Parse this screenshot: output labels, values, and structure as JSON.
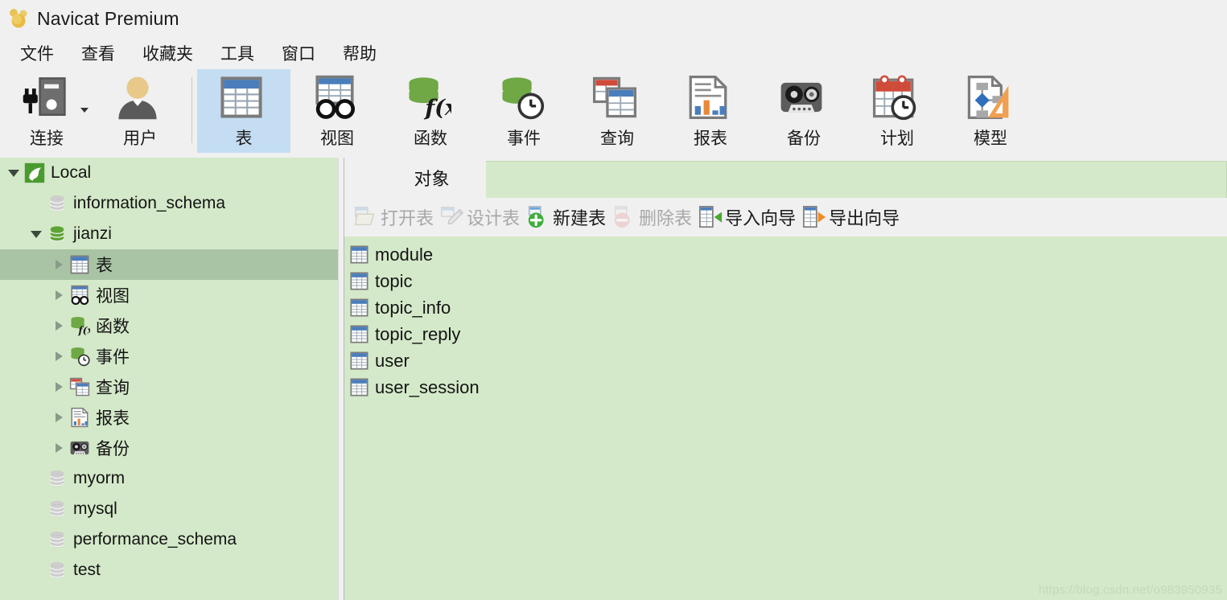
{
  "window": {
    "title": "Navicat Premium",
    "logo_icon": "navicat-logo-icon"
  },
  "menubar": {
    "items": [
      {
        "label": "文件",
        "name": "menu-file"
      },
      {
        "label": "查看",
        "name": "menu-view"
      },
      {
        "label": "收藏夹",
        "name": "menu-favorites"
      },
      {
        "label": "工具",
        "name": "menu-tools"
      },
      {
        "label": "窗口",
        "name": "menu-window"
      },
      {
        "label": "帮助",
        "name": "menu-help"
      }
    ]
  },
  "toolbar": {
    "buttons": [
      {
        "label": "连接",
        "icon": "connection-plug-icon",
        "selected": false,
        "has_caret": true
      },
      {
        "label": "用户",
        "icon": "user-icon",
        "selected": false,
        "has_caret": false
      },
      {
        "label": "表",
        "icon": "table-icon",
        "selected": true,
        "has_caret": false
      },
      {
        "label": "视图",
        "icon": "view-glasses-icon",
        "selected": false,
        "has_caret": false
      },
      {
        "label": "函数",
        "icon": "function-fx-icon",
        "selected": false,
        "has_caret": false
      },
      {
        "label": "事件",
        "icon": "event-clock-icon",
        "selected": false,
        "has_caret": false
      },
      {
        "label": "查询",
        "icon": "query-tables-icon",
        "selected": false,
        "has_caret": false
      },
      {
        "label": "报表",
        "icon": "report-chart-icon",
        "selected": false,
        "has_caret": false
      },
      {
        "label": "备份",
        "icon": "backup-tape-icon",
        "selected": false,
        "has_caret": false
      },
      {
        "label": "计划",
        "icon": "schedule-calendar-icon",
        "selected": false,
        "has_caret": false
      },
      {
        "label": "模型",
        "icon": "model-diagram-icon",
        "selected": false,
        "has_caret": false
      }
    ]
  },
  "sidebar": {
    "tree": [
      {
        "label": "Local",
        "icon": "mysql-dolphin-icon",
        "indent": 0,
        "expander": "down",
        "selected": false
      },
      {
        "label": "information_schema",
        "icon": "database-grey-icon",
        "indent": 1,
        "expander": "none",
        "selected": false
      },
      {
        "label": "jianzi",
        "icon": "database-green-icon",
        "indent": 1,
        "expander": "down",
        "selected": false
      },
      {
        "label": "表",
        "icon": "table-icon",
        "indent": 2,
        "expander": "right",
        "selected": true
      },
      {
        "label": "视图",
        "icon": "view-glasses-icon",
        "indent": 2,
        "expander": "right",
        "selected": false
      },
      {
        "label": "函数",
        "icon": "function-fx-icon",
        "indent": 2,
        "expander": "right",
        "selected": false
      },
      {
        "label": "事件",
        "icon": "event-clock-icon",
        "indent": 2,
        "expander": "right",
        "selected": false
      },
      {
        "label": "查询",
        "icon": "query-tables-icon",
        "indent": 2,
        "expander": "right",
        "selected": false
      },
      {
        "label": "报表",
        "icon": "report-chart-icon",
        "indent": 2,
        "expander": "right",
        "selected": false
      },
      {
        "label": "备份",
        "icon": "backup-tape-icon",
        "indent": 2,
        "expander": "right",
        "selected": false
      },
      {
        "label": "myorm",
        "icon": "database-grey-icon",
        "indent": 1,
        "expander": "none",
        "selected": false
      },
      {
        "label": "mysql",
        "icon": "database-grey-icon",
        "indent": 1,
        "expander": "none",
        "selected": false
      },
      {
        "label": "performance_schema",
        "icon": "database-grey-icon",
        "indent": 1,
        "expander": "none",
        "selected": false
      },
      {
        "label": "test",
        "icon": "database-grey-icon",
        "indent": 1,
        "expander": "none",
        "selected": false
      }
    ]
  },
  "main": {
    "tabs": [
      {
        "label": "对象",
        "active": true
      }
    ],
    "object_toolbar": [
      {
        "label": "打开表",
        "icon": "open-table-icon",
        "disabled": true
      },
      {
        "label": "设计表",
        "icon": "design-table-pencil-icon",
        "disabled": true
      },
      {
        "label": "新建表",
        "icon": "new-table-plus-icon",
        "disabled": false
      },
      {
        "label": "删除表",
        "icon": "delete-table-minus-icon",
        "disabled": true
      },
      {
        "label": "导入向导",
        "icon": "import-wizard-icon",
        "disabled": false
      },
      {
        "label": "导出向导",
        "icon": "export-wizard-icon",
        "disabled": false
      }
    ],
    "objects": [
      {
        "name": "module",
        "icon": "table-icon"
      },
      {
        "name": "topic",
        "icon": "table-icon"
      },
      {
        "name": "topic_info",
        "icon": "table-icon"
      },
      {
        "name": "topic_reply",
        "icon": "table-icon"
      },
      {
        "name": "user",
        "icon": "table-icon"
      },
      {
        "name": "user_session",
        "icon": "table-icon"
      }
    ]
  },
  "watermark": {
    "text": "https://blog.csdn.net/o983950935"
  },
  "colors": {
    "window_bg": "#f0f0f0",
    "panel_green": "#d4e9c9",
    "selection_green": "#a9c4a4",
    "selection_blue": "#c4ddf2",
    "table_header_blue": "#4a7ebb",
    "db_green": "#6fa845",
    "accent_orange": "#e8883a",
    "accent_red": "#cf4b3a"
  }
}
